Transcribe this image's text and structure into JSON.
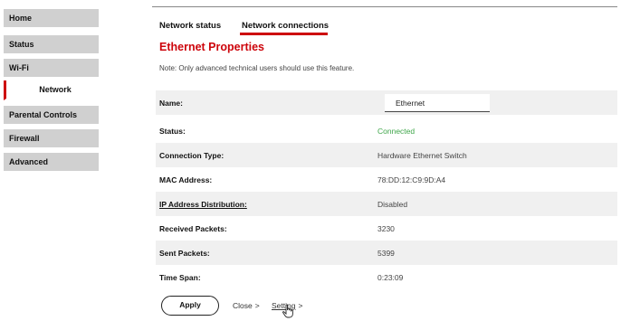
{
  "sidebar": {
    "items": [
      {
        "label": "Home",
        "active": false
      },
      {
        "label": "Status",
        "active": false
      },
      {
        "label": "Wi-Fi",
        "active": false
      },
      {
        "label": "Network",
        "active": true
      },
      {
        "label": "Parental Controls",
        "active": false
      },
      {
        "label": "Firewall",
        "active": false
      },
      {
        "label": "Advanced",
        "active": false
      }
    ]
  },
  "tabs": [
    {
      "label": "Network status",
      "active": false
    },
    {
      "label": "Network connections",
      "active": true
    }
  ],
  "page": {
    "title": "Ethernet Properties",
    "note": "Note: Only advanced technical users should use this feature."
  },
  "properties": {
    "name": {
      "label": "Name:",
      "value": "Ethernet"
    },
    "status": {
      "label": "Status:",
      "value": "Connected"
    },
    "connection_type": {
      "label": "Connection Type:",
      "value": "Hardware Ethernet Switch"
    },
    "mac": {
      "label": "MAC Address:",
      "value": "78:DD:12:C9:9D:A4"
    },
    "ip_distribution": {
      "label": "IP Address Distribution:",
      "value": "Disabled"
    },
    "received": {
      "label": "Received Packets:",
      "value": "3230"
    },
    "sent": {
      "label": "Sent Packets:",
      "value": "5399"
    },
    "time_span": {
      "label": "Time Span:",
      "value": "0:23:09"
    }
  },
  "footer": {
    "apply": "Apply",
    "close": "Close",
    "setting": "Setting",
    "chevron": ">"
  },
  "colors": {
    "accent": "#cd040b",
    "connected": "#3fa64a",
    "sidebar_bg": "#d0d0d0"
  }
}
